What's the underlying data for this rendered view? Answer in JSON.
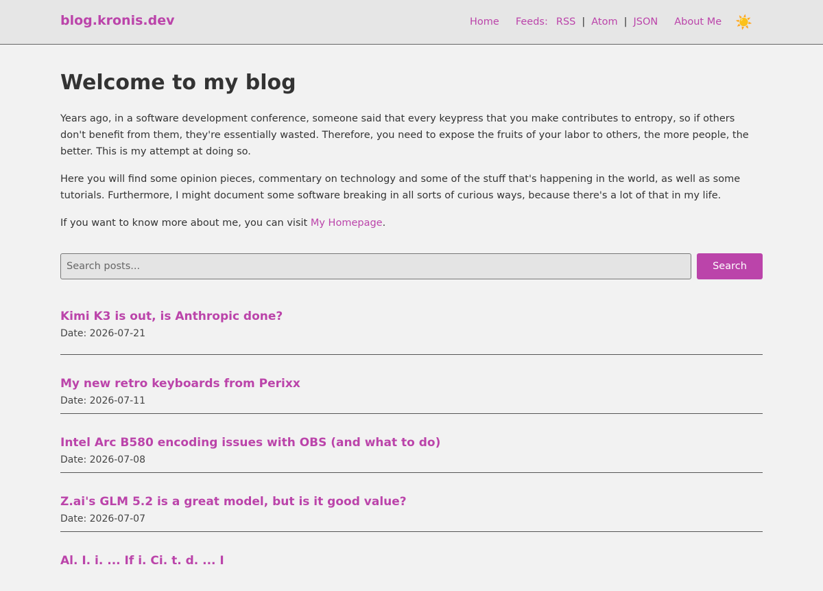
{
  "header": {
    "brand": "blog.kronis.dev",
    "nav": {
      "home": "Home",
      "feeds_label": "Feeds:",
      "rss": "RSS",
      "atom": "Atom",
      "json": "JSON",
      "separator": "|",
      "about": "About Me"
    },
    "theme_icon": "sun-icon",
    "theme_glyph": "☀️"
  },
  "main": {
    "title": "Welcome to my blog",
    "intro": {
      "p1": "Years ago, in a software development conference, someone said that every keypress that you make contributes to entropy, so if others don't benefit from them, they're essentially wasted. Therefore, you need to expose the fruits of your labor to others, the more people, the better. This is my attempt at doing so.",
      "p2": "Here you will find some opinion pieces, commentary on technology and some of the stuff that's happening in the world, as well as some tutorials. Furthermore, I might document some software breaking in all sorts of curious ways, because there's a lot of that in my life.",
      "p3_prefix": "If you want to know more about me, you can visit ",
      "p3_link": "My Homepage",
      "p3_suffix": "."
    },
    "search": {
      "placeholder": "Search posts...",
      "button": "Search"
    },
    "posts": [
      {
        "title": "Kimi K3 is out, is Anthropic done?",
        "date": "Date: 2026-07-21"
      },
      {
        "title": "My new retro keyboards from Perixx",
        "date": "Date: 2026-07-11"
      },
      {
        "title": "Intel Arc B580 encoding issues with OBS (and what to do)",
        "date": "Date: 2026-07-08"
      },
      {
        "title": "Z.ai's GLM 5.2 is a great model, but is it good value?",
        "date": "Date: 2026-07-07"
      },
      {
        "title": "Al. I. i. ... If i. Ci. t. d. ... I",
        "date": ""
      }
    ]
  },
  "colors": {
    "accent": "#bb44aa",
    "background": "#f2f2f2",
    "header_background": "#e6e6e6",
    "text": "#333333"
  }
}
